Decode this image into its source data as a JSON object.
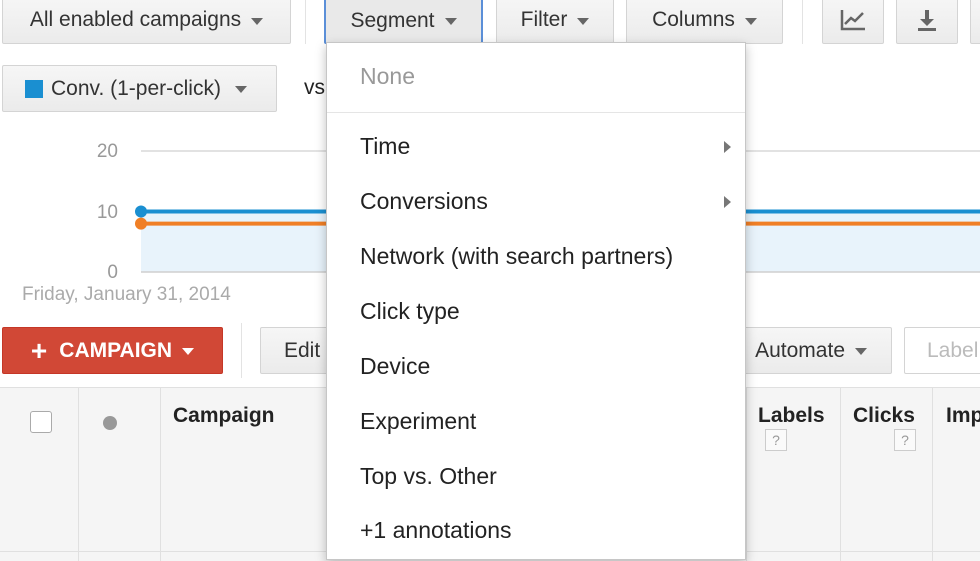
{
  "toolbar": {
    "campaign_filter_label": "All enabled campaigns",
    "segment_label": "Segment",
    "filter_label": "Filter",
    "columns_label": "Columns"
  },
  "chart_controls": {
    "metric_label": "Conv. (1-per-click)",
    "metric_color": "#1a8fd1",
    "vs_label": "vs"
  },
  "chart_data": {
    "type": "line",
    "y_ticks": [
      "20",
      "10",
      "0"
    ],
    "ylim": [
      0,
      20
    ],
    "x_label": "Friday, January 31, 2014",
    "series": [
      {
        "color": "#1a8fd1",
        "values": [
          10,
          10
        ]
      },
      {
        "color": "#f07f26",
        "values": [
          8,
          8
        ]
      }
    ]
  },
  "actions": {
    "add_campaign_label": "CAMPAIGN",
    "edit_label": "Edit",
    "automate_label": "Automate",
    "labels_label": "Label"
  },
  "table": {
    "headers": {
      "campaign": "Campaign",
      "labels": "Labels",
      "clicks": "Clicks",
      "impressions": "Imp"
    },
    "help_glyph": "?"
  },
  "segment_menu": {
    "none_label": "None",
    "items": [
      {
        "label": "Time",
        "submenu": true
      },
      {
        "label": "Conversions",
        "submenu": true
      },
      {
        "label": "Network (with search partners)",
        "submenu": false
      },
      {
        "label": "Click type",
        "submenu": false
      },
      {
        "label": "Device",
        "submenu": false
      },
      {
        "label": "Experiment",
        "submenu": false
      },
      {
        "label": "Top vs. Other",
        "submenu": false
      },
      {
        "label": "+1 annotations",
        "submenu": false
      }
    ]
  },
  "colors": {
    "accent_red": "#d14836",
    "series_blue": "#1a8fd1",
    "series_orange": "#f07f26",
    "area_fill": "#e8f3fb"
  }
}
